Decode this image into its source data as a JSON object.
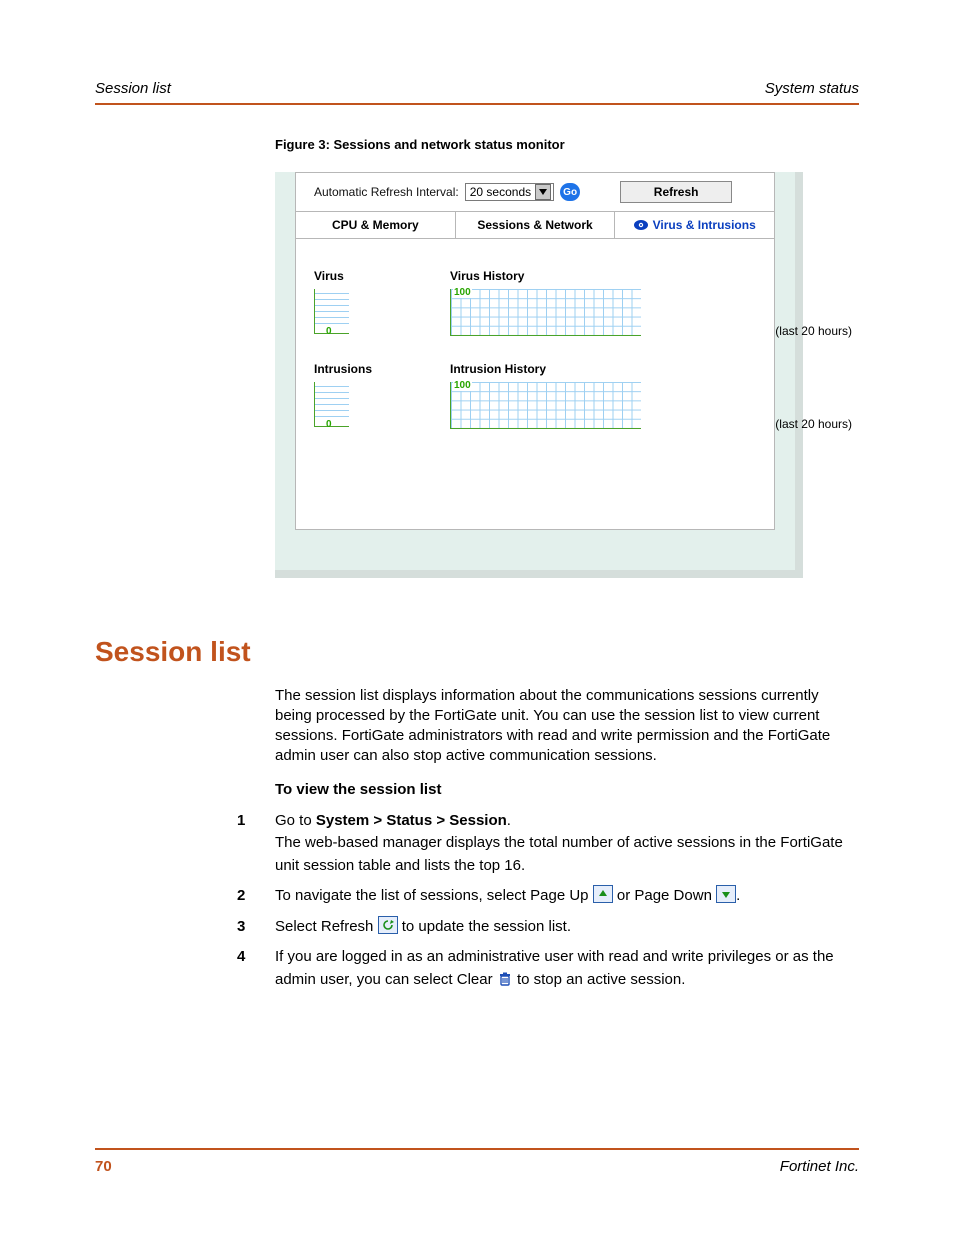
{
  "header": {
    "left": "Session list",
    "right": "System status"
  },
  "figure": {
    "caption": "Figure 3:   Sessions and network status monitor"
  },
  "monitor": {
    "refresh_label": "Automatic Refresh Interval:",
    "interval_value": "20 seconds",
    "go_label": "Go",
    "refresh_btn": "Refresh",
    "tabs": {
      "cpu": "CPU & Memory",
      "sess": "Sessions & Network",
      "vi": "Virus & Intrusions"
    },
    "panels": {
      "virus": {
        "title": "Virus",
        "zero": "0",
        "hist_title": "Virus History",
        "hist_ylabel": "100",
        "hist_caption": "(last 20 hours)"
      },
      "intrusions": {
        "title": "Intrusions",
        "zero": "0",
        "hist_title": "Intrusion History",
        "hist_ylabel": "100",
        "hist_caption": "(last 20 hours)"
      }
    }
  },
  "section": {
    "title": "Session list",
    "intro": "The session list displays information about the communications sessions currently being processed by the FortiGate unit. You can use the session list to view current sessions. FortiGate administrators with read and write permission and the FortiGate admin user can also stop active communication sessions.",
    "proc_title": "To view the session list",
    "steps": {
      "s1a": "Go to ",
      "s1b": "System > Status > Session",
      "s1c": ".",
      "s1_sub": "The web-based manager displays the total number of active sessions in the FortiGate unit session table and lists the top 16.",
      "s2a": "To navigate the list of sessions, select Page Up ",
      "s2b": " or Page Down ",
      "s2c": ".",
      "s3a": "Select Refresh ",
      "s3b": " to update the session list.",
      "s4a": "If you are logged in as an administrative user with read and write privileges or as the admin user, you can select Clear ",
      "s4b": " to stop an active session."
    }
  },
  "footer": {
    "page": "70",
    "company": "Fortinet Inc."
  }
}
